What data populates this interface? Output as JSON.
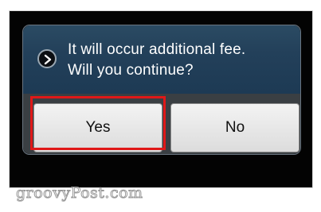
{
  "dialog": {
    "message_line1": "It will occur additional fee.",
    "message_line2": "Will you continue?",
    "icon": "chevron-right-icon",
    "yes_label": "Yes",
    "no_label": "No"
  },
  "watermark": {
    "text": "groovyPost.com"
  },
  "colors": {
    "highlight": "#e01818",
    "header_blue": "#23405a"
  }
}
